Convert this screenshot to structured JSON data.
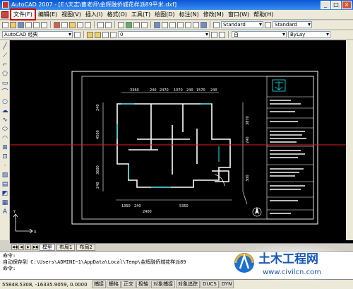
{
  "window": {
    "title": "AutoCAD 2007 - [E:\\天志\\曹老师\\金辉融侨城花样派89平米.dxf]"
  },
  "menu": {
    "items": [
      {
        "label": "文件(F)"
      },
      {
        "label": "编辑(E)"
      },
      {
        "label": "视图(V)"
      },
      {
        "label": "插入(I)"
      },
      {
        "label": "格式(O)"
      },
      {
        "label": "工具(T)"
      },
      {
        "label": "绘图(D)"
      },
      {
        "label": "标注(N)"
      },
      {
        "label": "修改(M)"
      },
      {
        "label": "窗口(W)"
      },
      {
        "label": "帮助(H)"
      }
    ]
  },
  "toolbar2": {
    "textstyle": "Standard",
    "dimstyle": "Standard"
  },
  "toolbar3": {
    "workspace": "AutoCAD 经典",
    "layer": "0",
    "color": "白",
    "linetype": "ByLay"
  },
  "drawing": {
    "dims_top": [
      "3360",
      "240",
      "2470",
      "1070",
      "240",
      "1570",
      "240"
    ],
    "dims_bottom": [
      "1350",
      "2400",
      "240",
      "5350"
    ],
    "dims_left": [
      "240",
      "4500",
      "3600",
      "240"
    ],
    "dims_right": [
      "3870",
      "240",
      "300"
    ]
  },
  "tabs": {
    "items": [
      {
        "label": "模型"
      },
      {
        "label": "布局1"
      },
      {
        "label": "布局2"
      }
    ]
  },
  "command": {
    "lines": [
      "命令:",
      "自动保存到 C:\\Users\\ADMINI~1\\AppData\\Local\\Temp\\金辉融侨城花样派89",
      "命令:"
    ]
  },
  "status": {
    "coords": "55848.5308, -16335.9059, 0.0000",
    "buttons": [
      "捕捉",
      "栅格",
      "正交",
      "极轴",
      "对象捕捉",
      "对象追踪",
      "DUCS",
      "DYN"
    ]
  },
  "watermark": {
    "name": "土木工程网",
    "url": "www.civilcn.com"
  }
}
